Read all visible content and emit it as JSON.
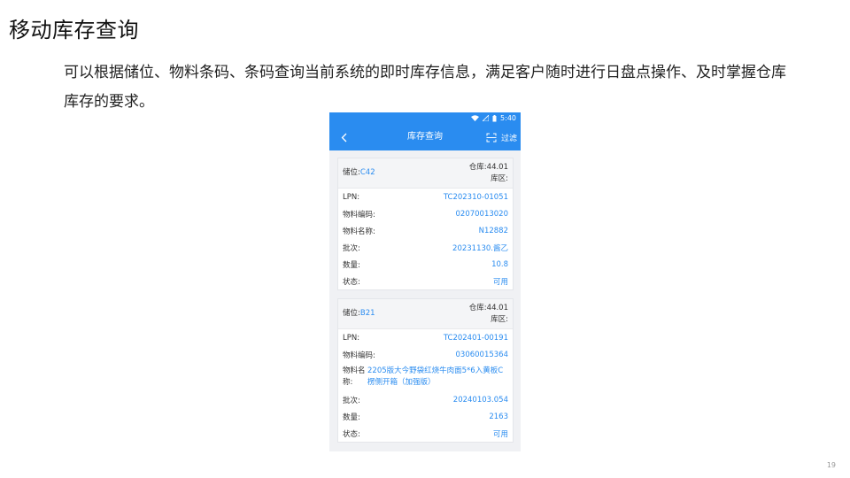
{
  "slide": {
    "title": "移动库存查询",
    "description": "可以根据储位、物料条码、条码查询当前系统的即时库存信息，满足客户随时进行日盘点操作、及时掌握仓库库存的要求。",
    "page_number": "19"
  },
  "phone": {
    "status_time": "5:40",
    "nav_title": "库存查询",
    "filter_label": "过滤",
    "cards": [
      {
        "location_label": "储位:",
        "location_value": "C42",
        "warehouse": "仓库:44.01",
        "zone": "库区:",
        "rows": [
          {
            "label": "LPN:",
            "value": "TC202310-01051"
          },
          {
            "label": "物料编码:",
            "value": "02070013020"
          },
          {
            "label": "物料名称:",
            "value": "N12882"
          },
          {
            "label": "批次:",
            "value": "20231130.酱乙"
          },
          {
            "label": "数量:",
            "value": "10.8"
          },
          {
            "label": "状态:",
            "value": "可用"
          }
        ]
      },
      {
        "location_label": "储位:",
        "location_value": "B21",
        "warehouse": "仓库:44.01",
        "zone": "库区:",
        "rows": [
          {
            "label": "LPN:",
            "value": "TC202401-00191"
          },
          {
            "label": "物料编码:",
            "value": "03060015364"
          },
          {
            "label": "物料名称:",
            "value": "2205版大今野袋红烧牛肉面5*6入黄板C楞侧开箱（加强版）"
          },
          {
            "label": "批次:",
            "value": "20240103.054"
          },
          {
            "label": "数量:",
            "value": "2163"
          },
          {
            "label": "状态:",
            "value": "可用"
          }
        ]
      }
    ]
  },
  "colors": {
    "accent": "#2a8cf0",
    "background": "#f0f1f4"
  }
}
